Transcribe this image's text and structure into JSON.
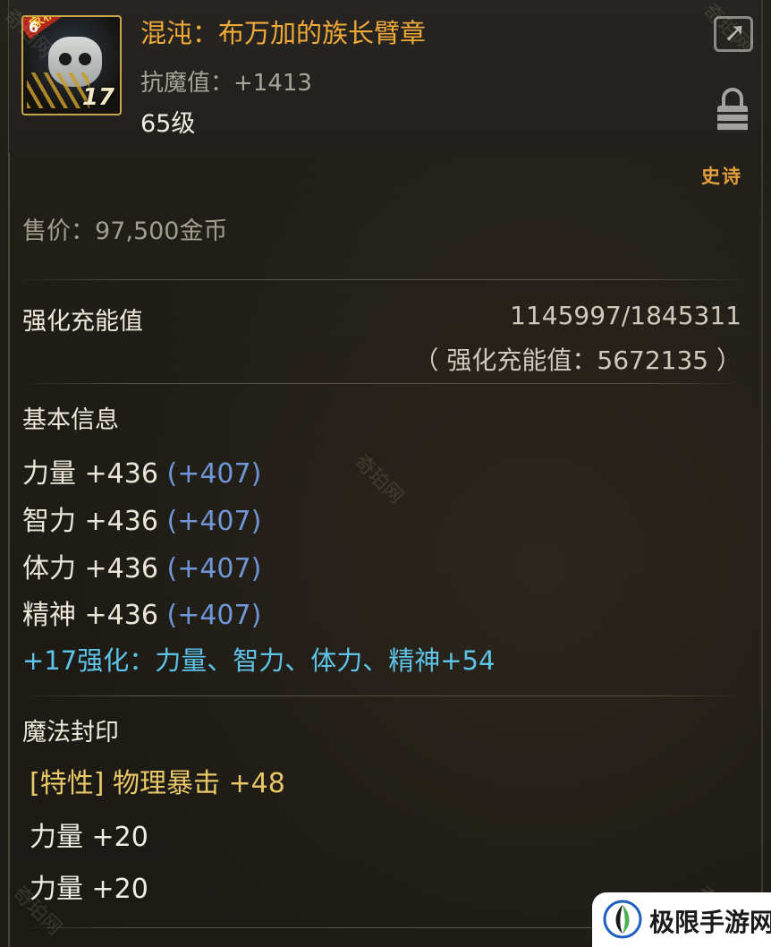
{
  "item": {
    "name": "混沌：布万加的族长臂章",
    "resist": "抗魔值：+1413",
    "level": "65级",
    "rarity": "史诗",
    "icon": {
      "flag": "家积中",
      "tag": "6",
      "enhance_level": "17"
    }
  },
  "price": "售价：97,500金币",
  "charge": {
    "label": "强化充能值",
    "value": "1145997/1845311",
    "total": "（ 强化充能值：5672135 ）"
  },
  "basic_info": {
    "label": "基本信息",
    "stats": [
      {
        "name": "力量 +436",
        "bonus": "(+407)"
      },
      {
        "name": "智力 +436",
        "bonus": "(+407)"
      },
      {
        "name": "体力 +436",
        "bonus": "(+407)"
      },
      {
        "name": "精神 +436",
        "bonus": "(+407)"
      }
    ],
    "enhance": "+17强化：力量、智力、体力、精神+54"
  },
  "seal": {
    "label": "魔法封印",
    "trait": "[特性] 物理暴击 +48",
    "rows": [
      "力量 +20",
      "力量 +20"
    ]
  },
  "watermark": "奇珀网",
  "badge": {
    "text": "极限手游网"
  },
  "colors": {
    "title": "#f1a93a",
    "bonus": "#6f96d6",
    "enhance": "#5ec3e8",
    "trait": "#e8c766",
    "rarity": "#e2a03c"
  },
  "icons": [
    "share-icon",
    "lock-icon",
    "item-icon"
  ]
}
